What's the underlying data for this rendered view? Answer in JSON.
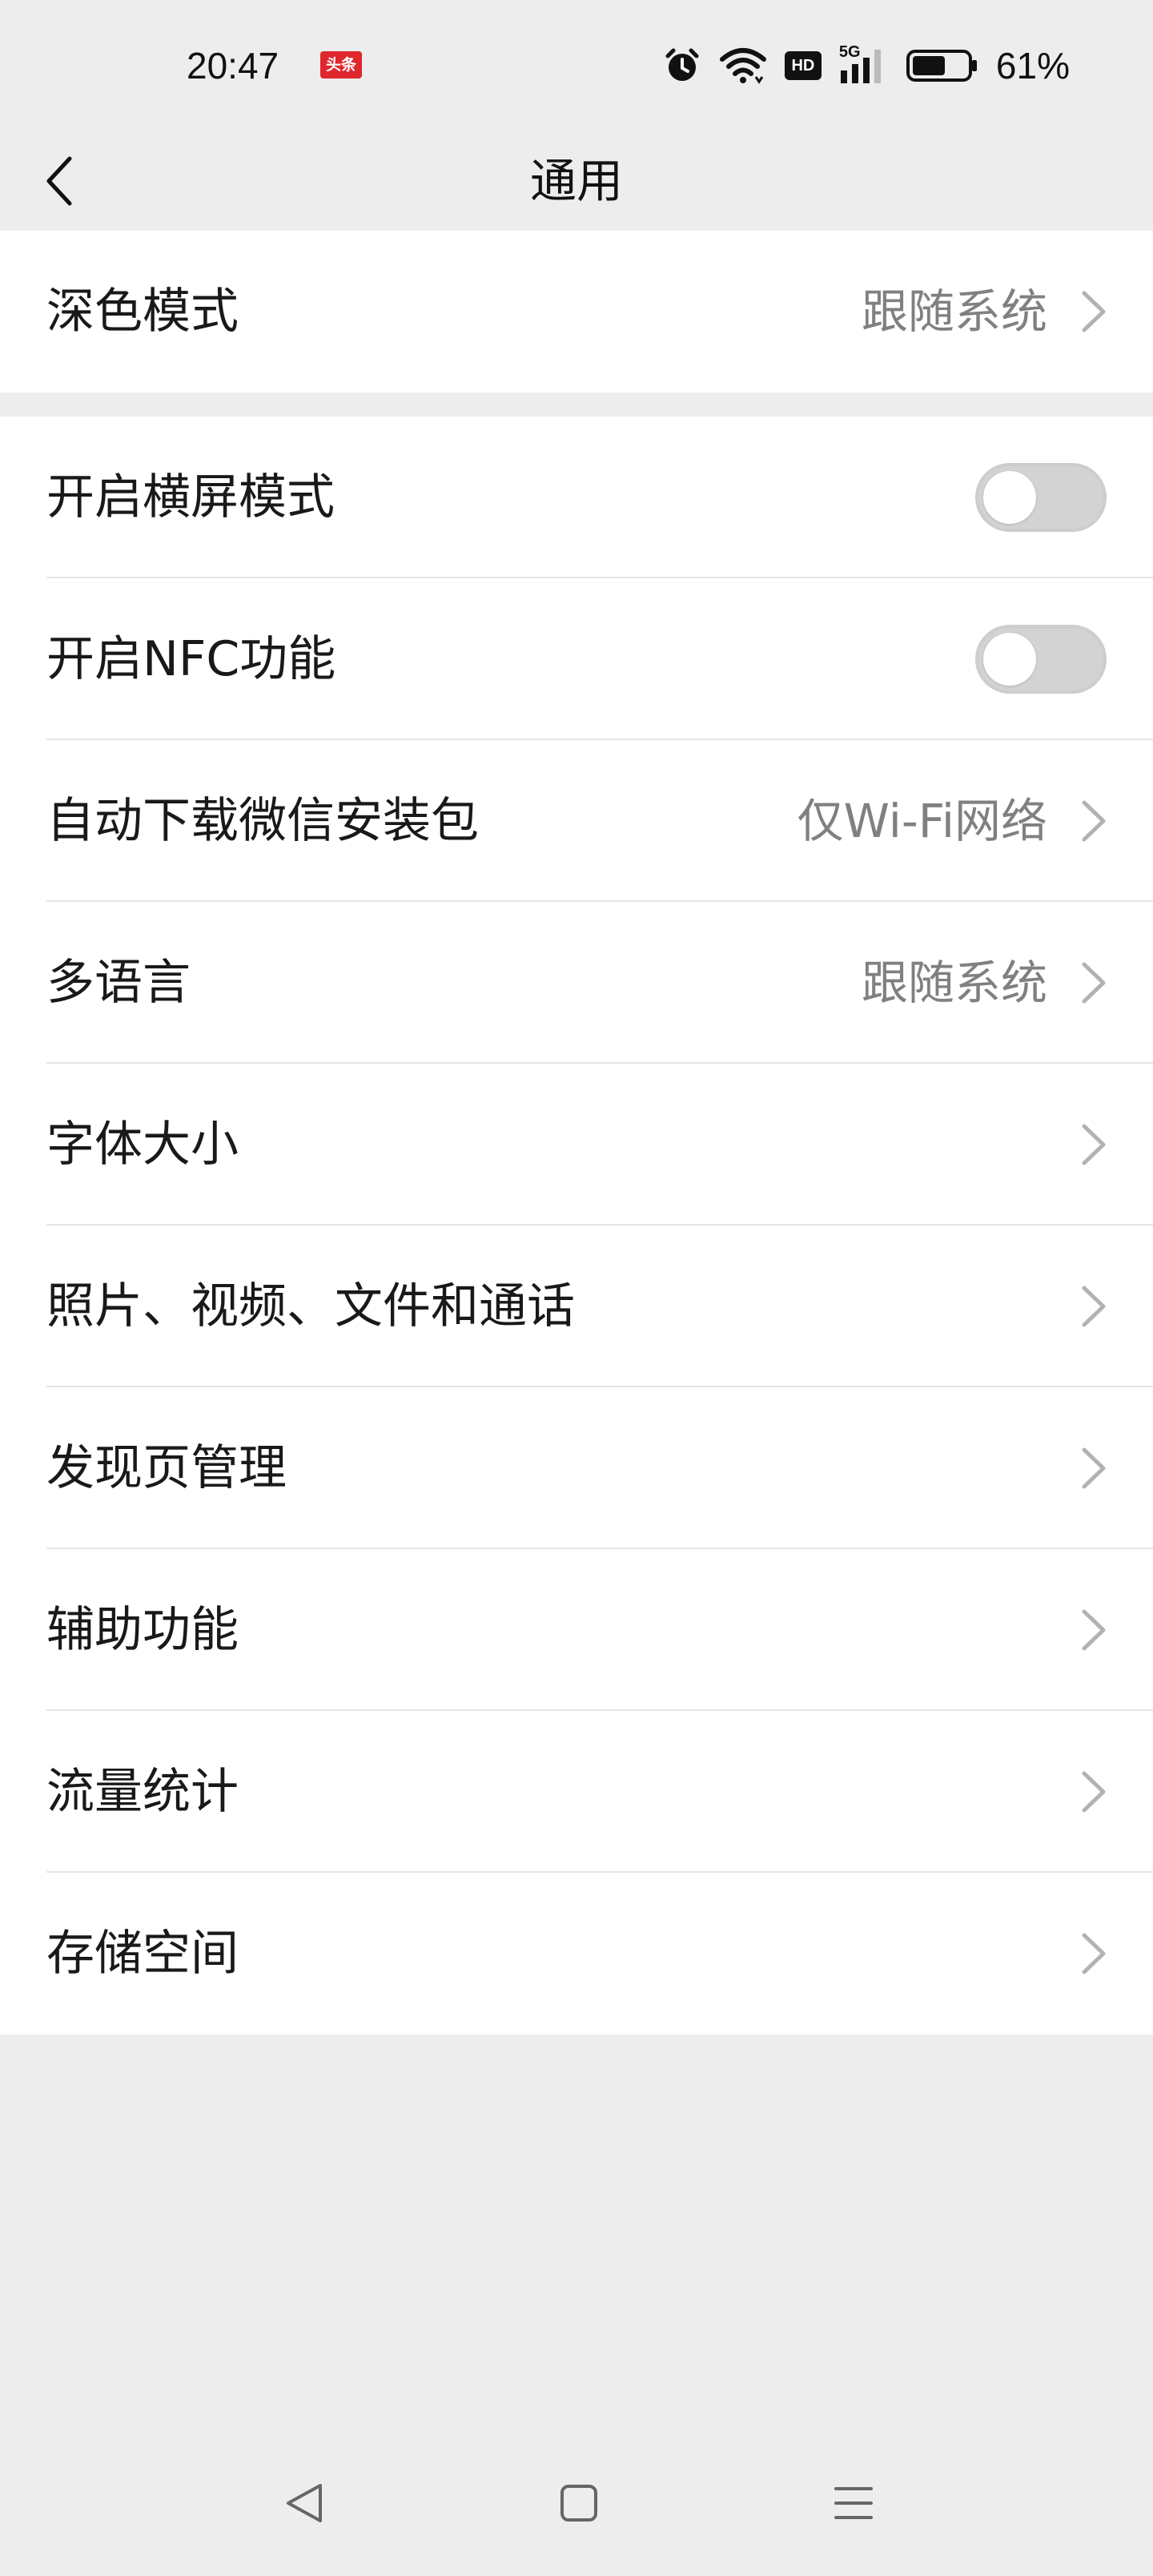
{
  "status_bar": {
    "time": "20:47",
    "badge": "头条",
    "icons": [
      "alarm-icon",
      "wifi-icon",
      "hd-icon",
      "5g-signal-icon",
      "battery-icon"
    ],
    "hd_label": "HD",
    "network_label": "5G",
    "battery_percent": "61%",
    "battery_level": 0.61
  },
  "nav": {
    "title": "通用",
    "back_icon": "back-chevron-icon"
  },
  "section1": {
    "rows": [
      {
        "label": "深色模式",
        "value": "跟随系统",
        "type": "link"
      }
    ]
  },
  "section2": {
    "rows": [
      {
        "label": "开启横屏模式",
        "type": "toggle",
        "on": false
      },
      {
        "label": "开启NFC功能",
        "type": "toggle",
        "on": false
      },
      {
        "label": "自动下载微信安装包",
        "value": "仅Wi-Fi网络",
        "type": "link"
      },
      {
        "label": "多语言",
        "value": "跟随系统",
        "type": "link"
      },
      {
        "label": "字体大小",
        "type": "link"
      },
      {
        "label": "照片、视频、文件和通话",
        "type": "link"
      },
      {
        "label": "发现页管理",
        "type": "link"
      },
      {
        "label": "辅助功能",
        "type": "link"
      },
      {
        "label": "流量统计",
        "type": "link"
      },
      {
        "label": "存储空间",
        "type": "link"
      }
    ]
  },
  "system_nav": {
    "buttons": [
      "back-triangle-icon",
      "home-square-icon",
      "menu-lines-icon"
    ]
  },
  "colors": {
    "background": "#ededed",
    "card": "#ffffff",
    "text": "#191919",
    "secondary_text": "#808080",
    "badge": "#e0262d",
    "toggle_off": "#d3d3d3"
  }
}
